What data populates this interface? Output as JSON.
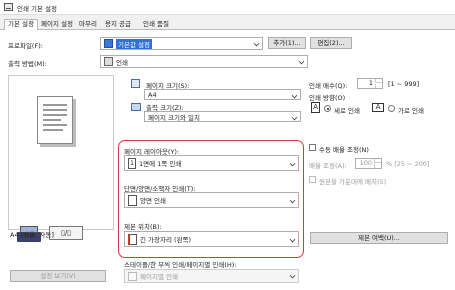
{
  "window": {
    "title": "인쇄 기본 설정"
  },
  "tabs": [
    "기본 설정",
    "페이지 설정",
    "마무리",
    "용지 공급",
    "인쇄 품질"
  ],
  "profile": {
    "label": "프로파일(F):",
    "value": "기본값 설정",
    "add_button": "추가(1)...",
    "edit_button": "편집(2)..."
  },
  "output": {
    "label": "출력 방법(M):",
    "value": "인쇄"
  },
  "page_size": {
    "label": "페이지 크기(S):",
    "value": "A4"
  },
  "output_size": {
    "label": "출력 크기(Z):",
    "value": "페이지 크기와 일치"
  },
  "copies": {
    "label": "인쇄 매수(Q):",
    "value": "1",
    "range": "[1 ~ 999]"
  },
  "orientation": {
    "label": "인쇄 방향(O)",
    "portrait": "세로 인쇄",
    "landscape": "가로 인쇄"
  },
  "layout": {
    "label": "페이지 레이아웃(Y):",
    "value": "1면에 1쪽 인쇄"
  },
  "manual_scale": {
    "label": "수동 배율 조정(N)",
    "scale_label": "배율 조정(A):",
    "scale_value": "100",
    "scale_range": "% [25 ~ 200]",
    "fit_label": "원본을 가운데에 배치(5)"
  },
  "duplex": {
    "label": "단면/양면/소책자 인쇄(T):",
    "value": "양면 인쇄"
  },
  "binding": {
    "label": "제본 위치(B):",
    "value": "긴 가장자리 (왼쪽)",
    "margin_button": "제본 여백(U)..."
  },
  "preview": {
    "caption": "A4 [배율: 자동]",
    "view_button": "설정 보기(V)"
  },
  "staple": {
    "label": "스테이플/한 부씩 인쇄/페이지별 인쇄(H):",
    "value": "페이지별 인쇄"
  }
}
